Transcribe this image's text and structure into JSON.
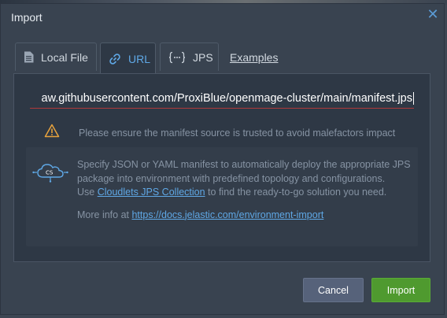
{
  "dialog": {
    "title": "Import"
  },
  "tabs": [
    {
      "label": "Local File",
      "icon": "file-icon"
    },
    {
      "label": "URL",
      "icon": "link-icon"
    },
    {
      "label": "JPS",
      "icon": "braces-icon"
    }
  ],
  "examples_link": "Examples",
  "url_field": {
    "value": "aw.githubusercontent.com/ProxiBlue/openmage-cluster/main/manifest.jps"
  },
  "warning": {
    "text": "Please ensure the manifest source is trusted to avoid malefactors impact"
  },
  "info": {
    "line1": "Specify JSON or YAML manifest to automatically deploy the appropriate JPS package into environment with predefined topology and configurations.",
    "use_prefix": "Use ",
    "collection_link": "Cloudlets JPS Collection",
    "use_suffix": " to find the ready-to-go solution you need.",
    "more_prefix": "More info at ",
    "more_link": "https://docs.jelastic.com/environment-import"
  },
  "buttons": {
    "cancel": "Cancel",
    "import": "Import"
  },
  "colors": {
    "accent": "#5fa8e6",
    "import_button": "#4f9a2f",
    "warning": "#e8a33d"
  }
}
